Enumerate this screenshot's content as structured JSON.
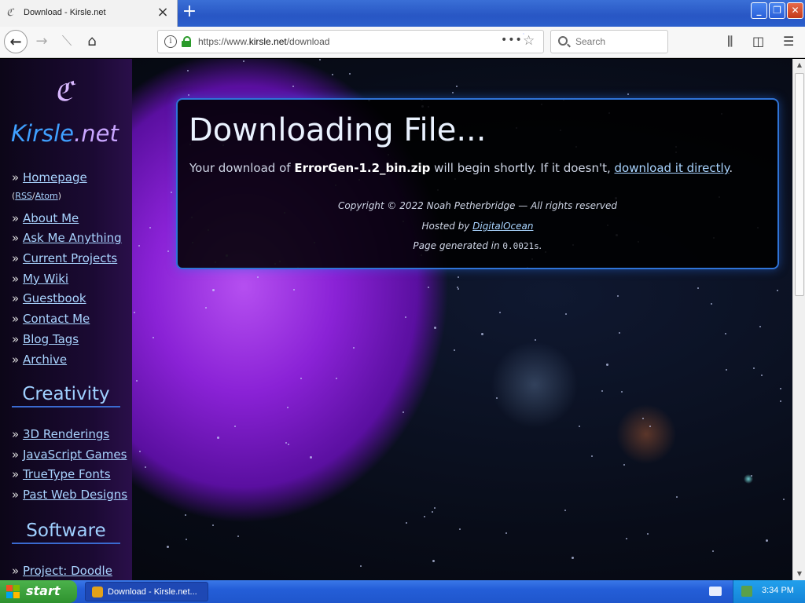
{
  "browser": {
    "tab_title": "Download - Kirsle.net",
    "url_prefix": "https://www.",
    "url_domain": "kirsle.net",
    "url_path": "/download",
    "search_placeholder": "Search",
    "new_tab_symbol": "+",
    "close_symbol": "×",
    "dots_symbol": "•••",
    "star_symbol": "☆",
    "menu_symbol": "☰",
    "library_symbol": "⫼",
    "sidebar_symbol": "◫",
    "info_symbol": "i"
  },
  "site": {
    "logo_glyph": "ℭ",
    "brand_main": "Kirsle",
    "brand_ext": ".net",
    "nav_main": [
      {
        "label": "Homepage"
      },
      {
        "label": "About Me"
      },
      {
        "label": "Ask Me Anything"
      },
      {
        "label": "Current Projects"
      },
      {
        "label": "My Wiki"
      },
      {
        "label": "Guestbook"
      },
      {
        "label": "Contact Me"
      },
      {
        "label": "Blog Tags"
      },
      {
        "label": "Archive"
      }
    ],
    "rss_label": "RSS",
    "atom_label": "Atom",
    "bullet": "»",
    "creativity_heading": "Creativity",
    "nav_creativity": [
      {
        "label": "3D Renderings"
      },
      {
        "label": "JavaScript Games"
      },
      {
        "label": "TrueType Fonts"
      },
      {
        "label": "Past Web Designs"
      }
    ],
    "software_heading": "Software",
    "nav_software": [
      {
        "label": "Project: Doodle"
      }
    ]
  },
  "download": {
    "title": "Downloading File...",
    "msg_pre": "Your download of ",
    "filename": "ErrorGen-1.2_bin.zip",
    "msg_mid": " will begin shortly. If it doesn't, ",
    "direct_link": "download it directly",
    "msg_end": ".",
    "copyright": "Copyright © 2022 Noah Petherbridge — All rights reserved",
    "hosted_pre": "Hosted by ",
    "host_link": "DigitalOcean",
    "generated_pre": "Page generated in ",
    "generated_time": "0.0021s",
    "generated_end": "."
  },
  "taskbar": {
    "start_label": "start",
    "task_label": "Download - Kirsle.net...",
    "clock": "3:34 PM"
  }
}
